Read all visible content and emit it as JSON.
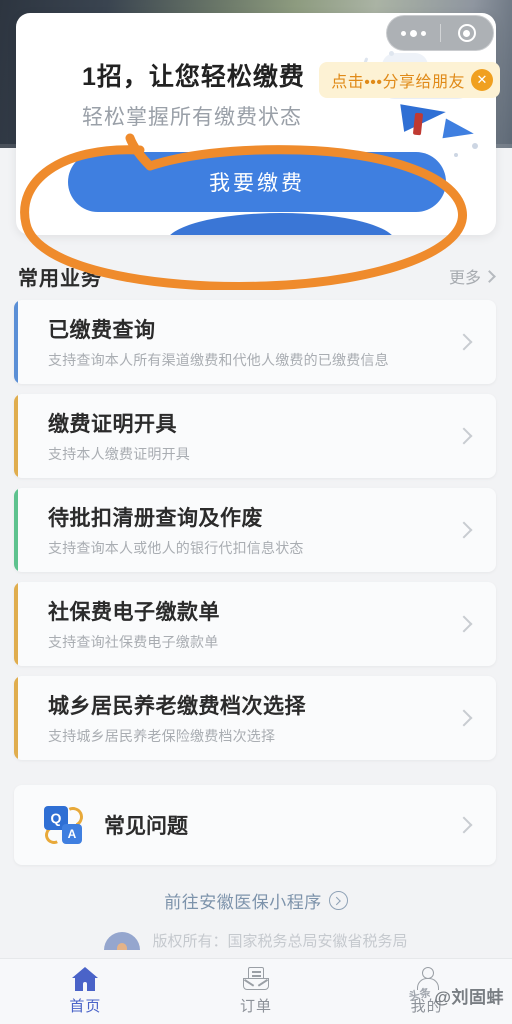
{
  "capsule": {
    "menu_icon": "more-dots-icon",
    "target_icon": "target-circle-icon"
  },
  "banner": {
    "title": "1招，让您轻松缴费",
    "subtitle": "轻松掌握所有缴费状态",
    "pay_button": "我要缴费"
  },
  "tooltip": {
    "text": "点击•••分享给朋友",
    "close": "✕"
  },
  "section": {
    "title": "常用业务",
    "more": "更多"
  },
  "list": [
    {
      "title": "已缴费查询",
      "desc": "支持查询本人所有渠道缴费和代他人缴费的已缴费信息",
      "accent": "#5b8fd6"
    },
    {
      "title": "缴费证明开具",
      "desc": "支持本人缴费证明开具",
      "accent": "#e0ad4e"
    },
    {
      "title": "待批扣清册查询及作废",
      "desc": "支持查询本人或他人的银行代扣信息状态",
      "accent": "#5ec28e"
    },
    {
      "title": "社保费电子缴款单",
      "desc": "支持查询社保费电子缴款单",
      "accent": "#e0ad4e"
    },
    {
      "title": "城乡居民养老缴费档次选择",
      "desc": "支持城乡居民养老保险缴费档次选择",
      "accent": "#e0ad4e"
    }
  ],
  "faq": {
    "label": "常见问题",
    "icon_q": "Q",
    "icon_a": "A"
  },
  "footer": {
    "link_text": "前往安徽医保小程序",
    "copyright": "版权所有：国家税务总局安徽省税务局"
  },
  "tabbar": [
    {
      "label": "首页",
      "icon": "home-icon",
      "active": true
    },
    {
      "label": "订单",
      "icon": "order-icon",
      "active": false
    },
    {
      "label": "我的",
      "icon": "user-icon",
      "active": false
    }
  ],
  "watermark": {
    "logo": "头条",
    "text": "@刘固蚌"
  },
  "colors": {
    "primary_blue": "#3f7fe0",
    "annotation_orange": "#ef8b2c",
    "tooltip_bg": "#fdf2d4",
    "tooltip_text": "#e08a18",
    "tab_active": "#4a63c8"
  }
}
